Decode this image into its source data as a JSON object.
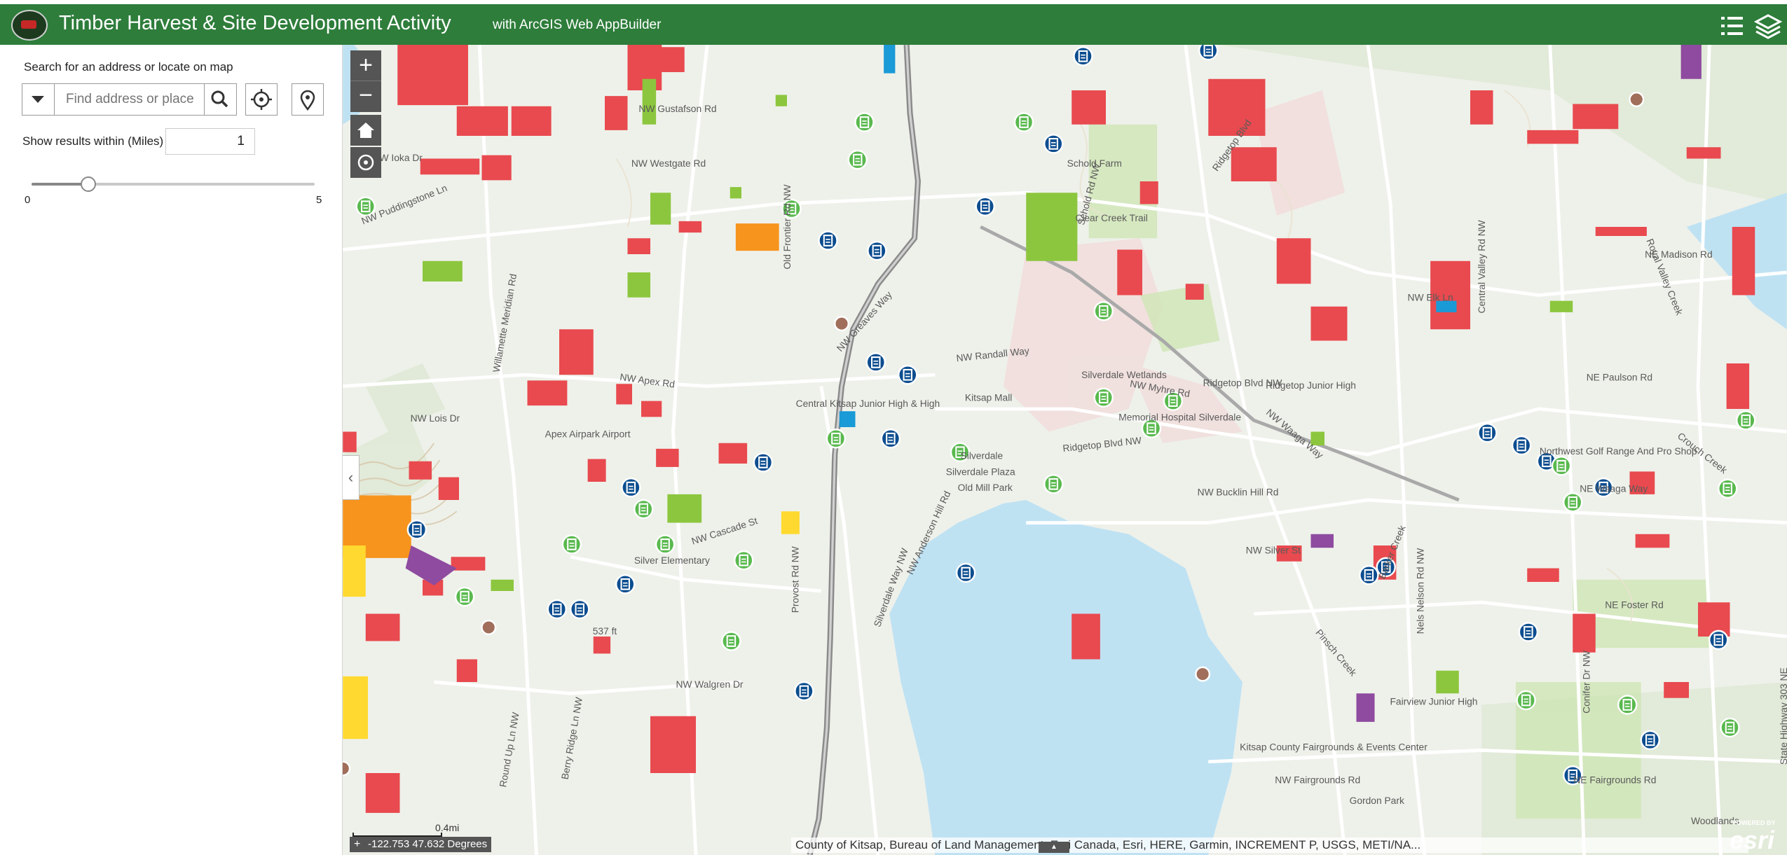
{
  "header": {
    "title": "Timber Harvest & Site Development Activity",
    "subtitle": "with ArcGIS Web AppBuilder",
    "icons": {
      "logo": "county-logo",
      "legend": "legend-list-icon",
      "layers": "layers-icon"
    }
  },
  "panel": {
    "search_label": "Search for an address or locate on map",
    "search_placeholder": "Find address or place",
    "radius_label": "Show results within (Miles)",
    "radius_value": "1",
    "slider": {
      "min_label": "0",
      "max_label": "5",
      "min": 0,
      "max": 5,
      "value": 1
    },
    "icons": {
      "source": "caret-down-icon",
      "search": "search-icon",
      "locate": "crosshair-icon",
      "pick": "map-pin-icon"
    }
  },
  "map": {
    "controls": {
      "zoom_in": "+",
      "zoom_out": "−",
      "collapse": "‹"
    },
    "scale_text": "0.4mi",
    "coordinates": "-122.753 47.632 Degrees",
    "coord_toggle": "+",
    "attribution": "County of Kitsap, Bureau of Land Management, Esri Canada, Esri, HERE, Garmin, INCREMENT P, USGS, METI/NA...",
    "esri": {
      "powered": "POWERED BY",
      "name": "esri"
    },
    "legend_colors": {
      "forest_practice": "#e84a4f",
      "site_development": "#8cc63e",
      "orange": "#f7941d",
      "purple": "#8e4b9f",
      "yellow": "#ffd92f",
      "blue": "#1a9ad6",
      "water": "#bfe2f3",
      "permit_marker": "#0b4d8f",
      "green_marker": "#59b94e"
    },
    "places": [
      {
        "name": "NW Gustafson Rd"
      },
      {
        "name": "NW Westgate Rd"
      },
      {
        "name": "NW Ioka Dr"
      },
      {
        "name": "NW Puddingstone Ln"
      },
      {
        "name": "Willamette Meridian Rd"
      },
      {
        "name": "Old Frontier Rd NW"
      },
      {
        "name": "Schold Farm"
      },
      {
        "name": "Clear Creek Trail"
      },
      {
        "name": "Schold Rd NW"
      },
      {
        "name": "Ridgetop Blvd"
      },
      {
        "name": "NW Elk Ln"
      },
      {
        "name": "NE Madison Rd"
      },
      {
        "name": "Central Valley Rd NW"
      },
      {
        "name": "Royal Valley Creek"
      },
      {
        "name": "NW Greaves Way"
      },
      {
        "name": "NW Randall Way"
      },
      {
        "name": "Silverdale Wetlands"
      },
      {
        "name": "NW Myhre Rd"
      },
      {
        "name": "Ridgetop Junior High"
      },
      {
        "name": "NE Paulson Rd"
      },
      {
        "name": "NW Lois Dr"
      },
      {
        "name": "Apex Airpark Airport"
      },
      {
        "name": "NW Apex Rd"
      },
      {
        "name": "Central Kitsap Junior High & High"
      },
      {
        "name": "Kitsap Mall"
      },
      {
        "name": "Silverdale"
      },
      {
        "name": "Ridgetop Blvd NW"
      },
      {
        "name": "NW Waaga Way"
      },
      {
        "name": "Northwest Golf Range And Pro Shop"
      },
      {
        "name": "Crouch Creek"
      },
      {
        "name": "Silverdale Plaza"
      },
      {
        "name": "Old Mill Park"
      },
      {
        "name": "NW Bucklin Hill Rd"
      },
      {
        "name": "NE Waaga Way"
      },
      {
        "name": "NW Cascade St"
      },
      {
        "name": "Silver Elementary"
      },
      {
        "name": "NW Silver St"
      },
      {
        "name": "Barker Creek"
      },
      {
        "name": "Nels Nelson Rd NW"
      },
      {
        "name": "NE Foster Rd"
      },
      {
        "name": "Pinsch Creek"
      },
      {
        "name": "NW Walgren Dr"
      },
      {
        "name": "537 ft"
      },
      {
        "name": "Silverdale Way NW"
      },
      {
        "name": "NW Anderson Hill Rd"
      },
      {
        "name": "Kitsap County Fairgrounds & Events Center"
      },
      {
        "name": "NW Fairgrounds Rd"
      },
      {
        "name": "NE Fairgrounds Rd"
      },
      {
        "name": "Gordon Park"
      },
      {
        "name": "Woodlands"
      },
      {
        "name": "Berry Ridge Ln NW"
      },
      {
        "name": "Round Up Ln NW"
      },
      {
        "name": "State Highway 303 NE"
      },
      {
        "name": "Provost Rd NW"
      },
      {
        "name": "Conifer Dr NW"
      },
      {
        "name": "Memorial Hospital Silverdale"
      },
      {
        "name": "Ridgetop Blvd NW"
      },
      {
        "name": "Fairview Junior High"
      }
    ]
  }
}
